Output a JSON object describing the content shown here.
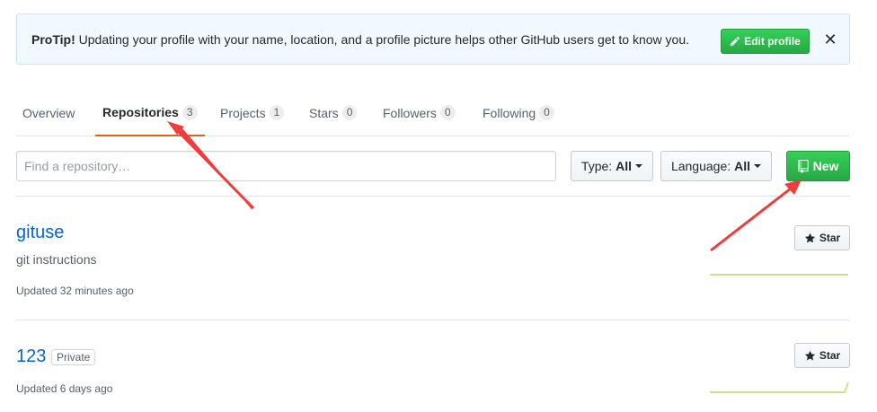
{
  "protip": {
    "label": "ProTip!",
    "message": " Updating your profile with your name, location, and a profile picture helps other GitHub users get to know you.",
    "edit_button": "Edit profile",
    "close_glyph": "✕"
  },
  "tabs": [
    {
      "label": "Overview",
      "count": null
    },
    {
      "label": "Repositories",
      "count": "3"
    },
    {
      "label": "Projects",
      "count": "1"
    },
    {
      "label": "Stars",
      "count": "0"
    },
    {
      "label": "Followers",
      "count": "0"
    },
    {
      "label": "Following",
      "count": "0"
    }
  ],
  "filter": {
    "search_placeholder": "Find a repository…",
    "type_label": "Type:",
    "type_value": "All",
    "language_label": "Language:",
    "language_value": "All",
    "new_button": "New"
  },
  "repos": [
    {
      "name": "gituse",
      "description": "git instructions",
      "updated": "Updated 32 minutes ago",
      "star_label": "Star"
    },
    {
      "name": "123",
      "badge": "Private",
      "updated": "Updated 6 days ago",
      "star_label": "Star"
    }
  ],
  "colors": {
    "accent_tab": "#e36209",
    "link": "#0366d6",
    "primary_green": "#28a745",
    "annotation_red": "#f03c3c"
  },
  "icons": {
    "edit": "pencil-icon",
    "close": "close-icon",
    "new_repo": "repo-icon",
    "star": "star-icon"
  }
}
